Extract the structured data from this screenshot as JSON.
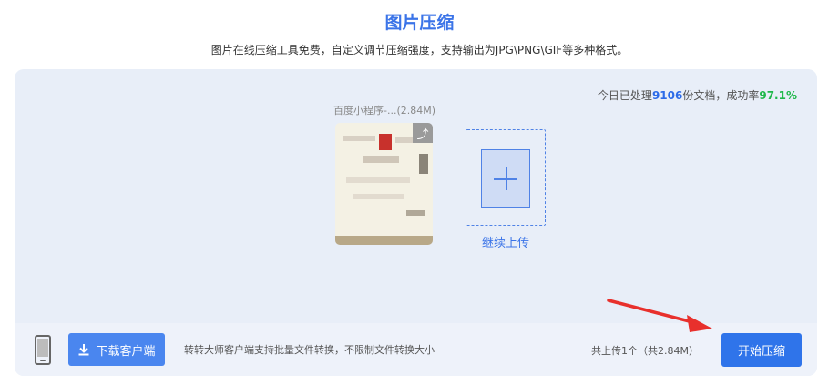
{
  "header": {
    "title": "图片压缩",
    "subtitle": "图片在线压缩工具免费，自定义调节压缩强度，支持输出为JPG\\PNG\\GIF等多种格式。"
  },
  "stats": {
    "prefix": "今日已处理",
    "processed_count": "9106",
    "middle": "份文档，成功率",
    "success_rate": "97.1%"
  },
  "file": {
    "name": "百度小程序-...(2.84M)",
    "action_icon": "swap-icon"
  },
  "upload": {
    "label": "继续上传",
    "icon": "plus-icon"
  },
  "bottom_bar": {
    "download_label": "下载客户端",
    "download_icon": "download-icon",
    "client_tip": "转转大师客户端支持批量文件转换，不限制文件转换大小",
    "upload_count": "共上传1个（共2.84M）",
    "start_label": "开始压缩"
  },
  "colors": {
    "accent": "#3b74e8",
    "primary_button": "#2f74ea",
    "success": "#1fb84a",
    "annotation_arrow": "#e8302c"
  }
}
